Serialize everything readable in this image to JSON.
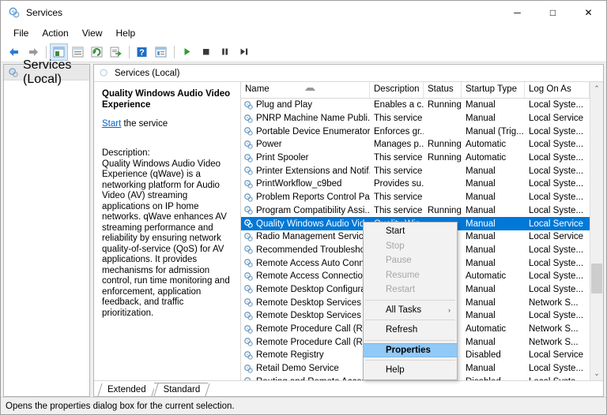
{
  "window": {
    "title": "Services",
    "icon": "services-gear-icon",
    "minimize_label": "─",
    "maximize_label": "□",
    "close_label": "✕"
  },
  "menubar": {
    "items": [
      {
        "label": "File"
      },
      {
        "label": "Action"
      },
      {
        "label": "View"
      },
      {
        "label": "Help"
      }
    ]
  },
  "toolbar": {
    "buttons": [
      {
        "name": "back-icon"
      },
      {
        "name": "forward-icon"
      },
      {
        "name": "show-hide-tree-icon"
      },
      {
        "name": "properties-icon"
      },
      {
        "name": "refresh-icon"
      },
      {
        "name": "export-list-icon"
      },
      {
        "name": "help-icon"
      },
      {
        "name": "view-icon"
      },
      {
        "name": "start-service-icon"
      },
      {
        "name": "stop-service-icon"
      },
      {
        "name": "pause-service-icon"
      },
      {
        "name": "restart-service-icon"
      }
    ]
  },
  "tree": {
    "node_label": "Services (Local)"
  },
  "content": {
    "header_label": "Services (Local)"
  },
  "detail": {
    "title": "Quality Windows Audio Video Experience",
    "action_link": "Start",
    "action_suffix": " the service",
    "description_label": "Description:",
    "description_body": "Quality Windows Audio Video Experience (qWave) is a networking platform for Audio Video (AV) streaming applications on IP home networks. qWave enhances AV streaming performance and reliability by ensuring network quality-of-service (QoS) for AV applications. It provides mechanisms for admission control, run time monitoring and enforcement, application feedback, and traffic prioritization."
  },
  "list": {
    "columns": [
      {
        "label": "Name",
        "sorted": true
      },
      {
        "label": "Description",
        "sorted": false
      },
      {
        "label": "Status",
        "sorted": false
      },
      {
        "label": "Startup Type",
        "sorted": false
      },
      {
        "label": "Log On As",
        "sorted": false
      }
    ],
    "rows": [
      {
        "name": "Plug and Play",
        "description": "Enables a c...",
        "status": "Running",
        "startup": "Manual",
        "logon": "Local Syste...",
        "selected": false
      },
      {
        "name": "PNRP Machine Name Publi...",
        "description": "This service ...",
        "status": "",
        "startup": "Manual",
        "logon": "Local Service",
        "selected": false
      },
      {
        "name": "Portable Device Enumerator...",
        "description": "Enforces gr...",
        "status": "",
        "startup": "Manual (Trig...",
        "logon": "Local Syste...",
        "selected": false
      },
      {
        "name": "Power",
        "description": "Manages p...",
        "status": "Running",
        "startup": "Automatic",
        "logon": "Local Syste...",
        "selected": false
      },
      {
        "name": "Print Spooler",
        "description": "This service ...",
        "status": "Running",
        "startup": "Automatic",
        "logon": "Local Syste...",
        "selected": false
      },
      {
        "name": "Printer Extensions and Notif...",
        "description": "This service ...",
        "status": "",
        "startup": "Manual",
        "logon": "Local Syste...",
        "selected": false
      },
      {
        "name": "PrintWorkflow_c9bed",
        "description": "Provides su...",
        "status": "",
        "startup": "Manual",
        "logon": "Local Syste...",
        "selected": false
      },
      {
        "name": "Problem Reports Control Pa...",
        "description": "This service ...",
        "status": "",
        "startup": "Manual",
        "logon": "Local Syste...",
        "selected": false
      },
      {
        "name": "Program Compatibility Assi...",
        "description": "This service ...",
        "status": "Running",
        "startup": "Manual",
        "logon": "Local Syste...",
        "selected": false
      },
      {
        "name": "Quality Windows Audio Vid...",
        "description": "Quality Win",
        "status": "",
        "startup": "Manual",
        "logon": "Local Service",
        "selected": true
      },
      {
        "name": "Radio Management Service",
        "description": "",
        "status": "",
        "startup": "Manual",
        "logon": "Local Service",
        "selected": false
      },
      {
        "name": "Recommended Troublesho...",
        "description": "",
        "status": "",
        "startup": "Manual",
        "logon": "Local Syste...",
        "selected": false
      },
      {
        "name": "Remote Access Auto Conne.",
        "description": "",
        "status": "",
        "startup": "Manual",
        "logon": "Local Syste...",
        "selected": false
      },
      {
        "name": "Remote Access Connection..",
        "description": "",
        "status": "",
        "startup": "Automatic",
        "logon": "Local Syste...",
        "selected": false
      },
      {
        "name": "Remote Desktop Configurat.",
        "description": "",
        "status": "",
        "startup": "Manual",
        "logon": "Local Syste...",
        "selected": false
      },
      {
        "name": "Remote Desktop Services",
        "description": "",
        "status": "",
        "startup": "Manual",
        "logon": "Network S...",
        "selected": false
      },
      {
        "name": "Remote Desktop Services U..",
        "description": "",
        "status": "",
        "startup": "Manual",
        "logon": "Local Syste...",
        "selected": false
      },
      {
        "name": "Remote Procedure Call (RPC",
        "description": "",
        "status": "",
        "startup": "Automatic",
        "logon": "Network S...",
        "selected": false
      },
      {
        "name": "Remote Procedure Call (RP...",
        "description": "",
        "status": "",
        "startup": "Manual",
        "logon": "Network S...",
        "selected": false
      },
      {
        "name": "Remote Registry",
        "description": "",
        "status": "",
        "startup": "Disabled",
        "logon": "Local Service",
        "selected": false
      },
      {
        "name": "Retail Demo Service",
        "description": "",
        "status": "",
        "startup": "Manual",
        "logon": "Local Syste...",
        "selected": false
      },
      {
        "name": "Routing and Remote Access",
        "description": "",
        "status": "",
        "startup": "Disabled",
        "logon": "Local Syste...",
        "selected": false
      }
    ]
  },
  "context_menu": {
    "items": [
      {
        "label": "Start",
        "disabled": false,
        "highlight": false,
        "separator_after": false,
        "submenu": false
      },
      {
        "label": "Stop",
        "disabled": true,
        "highlight": false,
        "separator_after": false,
        "submenu": false
      },
      {
        "label": "Pause",
        "disabled": true,
        "highlight": false,
        "separator_after": false,
        "submenu": false
      },
      {
        "label": "Resume",
        "disabled": true,
        "highlight": false,
        "separator_after": false,
        "submenu": false
      },
      {
        "label": "Restart",
        "disabled": true,
        "highlight": false,
        "separator_after": true,
        "submenu": false
      },
      {
        "label": "All Tasks",
        "disabled": false,
        "highlight": false,
        "separator_after": true,
        "submenu": true
      },
      {
        "label": "Refresh",
        "disabled": false,
        "highlight": false,
        "separator_after": true,
        "submenu": false
      },
      {
        "label": "Properties",
        "disabled": false,
        "highlight": true,
        "separator_after": true,
        "submenu": false
      },
      {
        "label": "Help",
        "disabled": false,
        "highlight": false,
        "separator_after": false,
        "submenu": false
      }
    ],
    "submenu_arrow": "›"
  },
  "tabs": [
    {
      "label": "Extended",
      "active": false
    },
    {
      "label": "Standard",
      "active": true
    }
  ],
  "statusbar": {
    "text": "Opens the properties dialog box for the current selection."
  },
  "scrollbar": {
    "up_arrow": "⌃",
    "down_arrow": "⌄",
    "thumb_top_pct": 62,
    "thumb_height_pct": 11
  },
  "colors": {
    "selection_blue": "#0078d7",
    "menu_highlight": "#91c9f7",
    "link_blue": "#0066cc",
    "window_bg": "#f0f0f0"
  }
}
